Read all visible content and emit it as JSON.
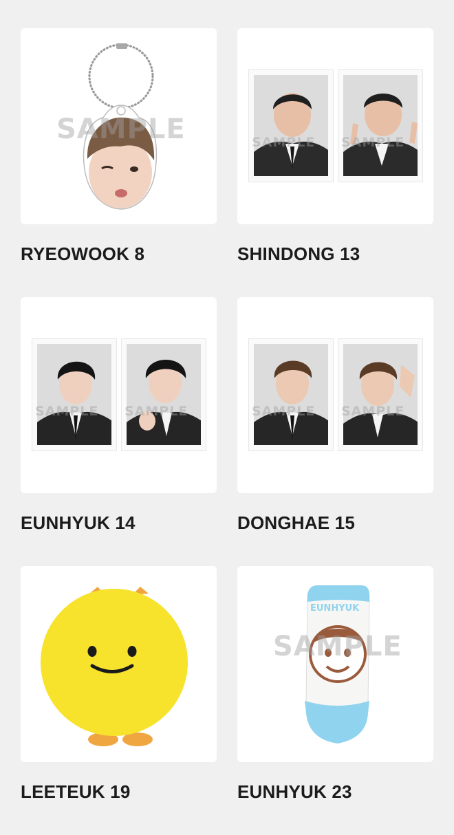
{
  "watermark": "SAMPLE",
  "items": [
    {
      "name": "RYEOWOOK",
      "number": "8",
      "label": "RYEOWOOK 8",
      "product": "acrylic-keyring"
    },
    {
      "name": "SHINDONG",
      "number": "13",
      "label": "SHINDONG 13",
      "product": "photo-set"
    },
    {
      "name": "EUNHYUK",
      "number": "14",
      "label": "EUNHYUK 14",
      "product": "photo-set"
    },
    {
      "name": "DONGHAE",
      "number": "15",
      "label": "DONGHAE 15",
      "product": "photo-set"
    },
    {
      "name": "LEETEUK",
      "number": "19",
      "label": "LEETEUK 19",
      "product": "character-cushion"
    },
    {
      "name": "EUNHYUK",
      "number": "23",
      "label": "EUNHYUK 23",
      "product": "ankle-socks"
    }
  ],
  "sock_print": "EUNHYUK",
  "colors": {
    "background": "#f0f0f0",
    "card": "#ffffff",
    "label_text": "#1b1b1b",
    "cushion_yellow": "#f7e22c",
    "sock_blue": "#8fd3ef",
    "sock_brown": "#9a5a3c"
  }
}
